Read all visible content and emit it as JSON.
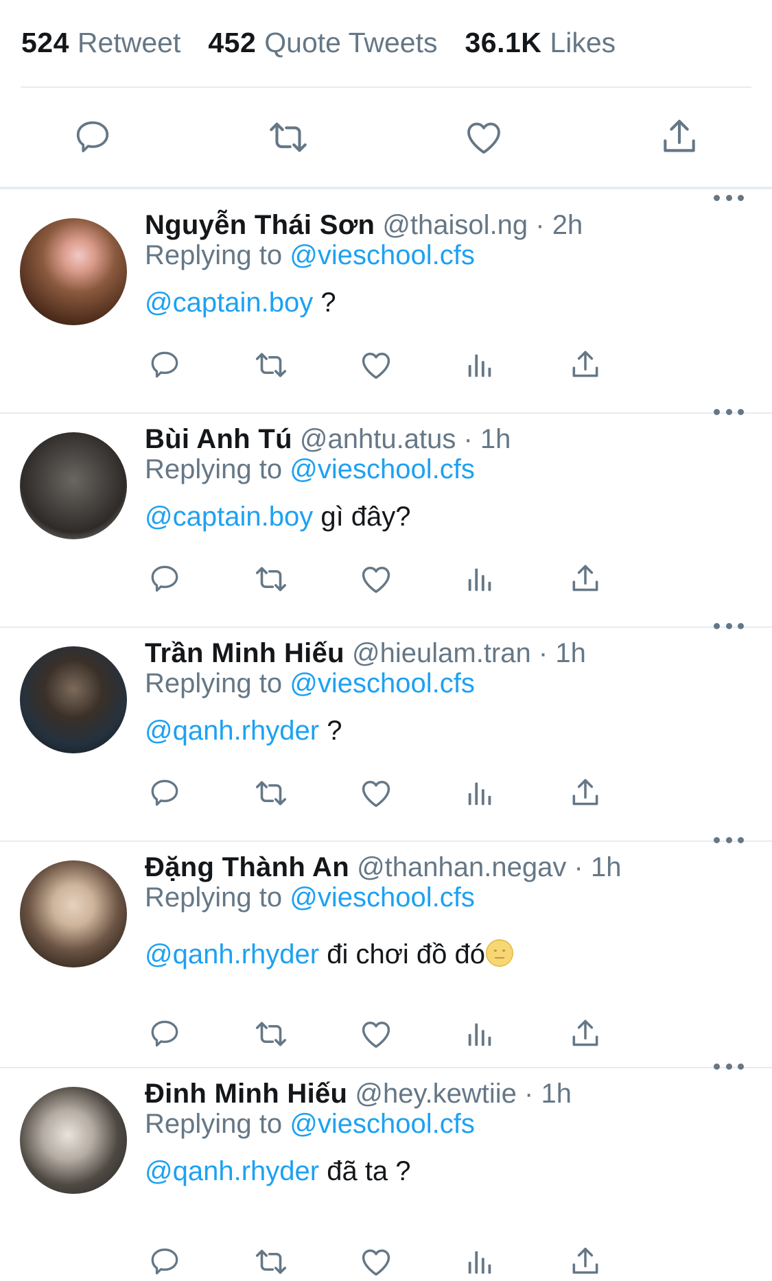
{
  "stats": {
    "retweets": {
      "count": "524",
      "label": "Retweet"
    },
    "quotes": {
      "count": "452",
      "label": "Quote Tweets"
    },
    "likes": {
      "count": "36.1K",
      "label": "Likes"
    }
  },
  "icons": {
    "reply": "speech-bubble-icon",
    "retweet": "retweet-arrows-icon",
    "like": "heart-outline-icon",
    "analytics": "bar-chart-icon",
    "share": "share-upload-icon",
    "more": "more-dots-icon",
    "emoji": "neutral-face-emoji"
  },
  "colors": {
    "link": "#1da1f2",
    "secondary": "#657786",
    "text": "#14171a",
    "divider": "#e6ecf0"
  },
  "replies": [
    {
      "name": "Nguyễn Thái Sơn",
      "handle": "@thaisol.ng",
      "dot": "·",
      "time": "2h",
      "replying_label": "Replying to",
      "replying_handle": "@vieschool.cfs",
      "mention": "@captain.boy",
      "text": " ?"
    },
    {
      "name": "Bùi Anh Tú",
      "handle": "@anhtu.atus",
      "dot": "·",
      "time": "1h",
      "replying_label": "Replying to",
      "replying_handle": "@vieschool.cfs",
      "mention": "@captain.boy",
      "text": " gì đây?"
    },
    {
      "name": "Trần Minh Hiếu",
      "handle": "@hieulam.tran",
      "dot": "·",
      "time": "1h",
      "replying_label": "Replying to",
      "replying_handle": "@vieschool.cfs",
      "mention": "@qanh.rhyder",
      "text": " ?"
    },
    {
      "name": "Đặng Thành An",
      "handle": "@thanhan.negav",
      "dot": "·",
      "time": "1h",
      "replying_label": "Replying to",
      "replying_handle": "@vieschool.cfs",
      "mention": "@qanh.rhyder",
      "text": " đi chơi đồ đó"
    },
    {
      "name": "Đinh Minh Hiếu",
      "handle": "@hey.kewtiie",
      "dot": "·",
      "time": "1h",
      "replying_label": "Replying to",
      "replying_handle": "@vieschool.cfs",
      "mention": "@qanh.rhyder",
      "text": " đã ta ?"
    }
  ]
}
